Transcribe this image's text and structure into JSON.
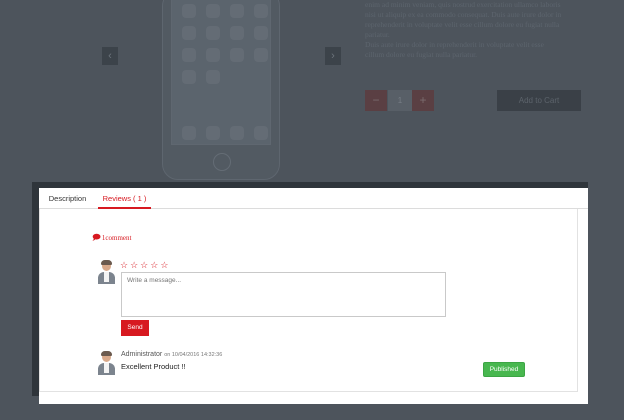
{
  "background": {
    "description_lines": [
      "enim ad minim veniam, quis nostrud exercitation ullamco laboris",
      "nisi ut aliquip ex ea commodo consequat. Duis aute irure dolor in",
      "reprehenderit in voluptate velit esse cillum dolore eu fugiat nulla",
      "pariatur.",
      "Duis aute irure dolor in reprehenderit in voluptate velit esse",
      "cillum dolore eu fugiat nulla pariatur."
    ],
    "gallery_prev_label": "‹",
    "gallery_next_label": "›",
    "qty_minus_label": "−",
    "qty_value": "1",
    "qty_plus_label": "+",
    "add_to_cart_label": "Add to Cart"
  },
  "tabs": [
    {
      "label": "Description",
      "active": false
    },
    {
      "label": "Reviews ( 1 )",
      "active": true
    }
  ],
  "reviews": {
    "comment_icon": "comment-icon",
    "comment_count": "1comment",
    "rating_stars": 5,
    "star_glyph": "☆",
    "message_placeholder": "Write a message...",
    "send_label": "Send",
    "items": [
      {
        "author": "Administrator",
        "date": "on 10/04/2016 14:32:36",
        "text": "Excellent Product !!",
        "status": "Published"
      }
    ]
  },
  "colors": {
    "accent": "#d71920",
    "published": "#48b74f",
    "overlay": "#4b535b"
  }
}
